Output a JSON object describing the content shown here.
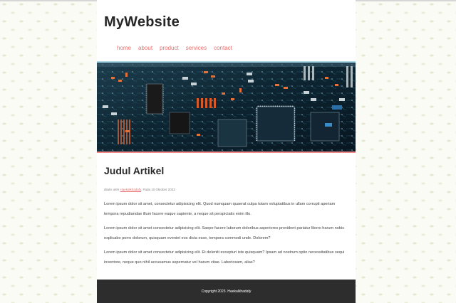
{
  "site": {
    "title": "MyWebsite"
  },
  "nav": {
    "items": [
      "home",
      "about",
      "product",
      "services",
      "contact"
    ]
  },
  "banner": {
    "image": "circuit-board-photo"
  },
  "article": {
    "title": "Judul Artikel",
    "meta_prefix": "ditulis oleh",
    "meta_author": "Haekalkhadafy",
    "meta_suffix": ", Pada 10 Oktober 2023",
    "paragraphs": [
      "Lorem ipsum dolor sit amet, consectetur adipisicing elit. Quod numquam quaerat culpa totam voluptatibus in ullam corrupti aperiam tempora repudiandae illum facere eaque sapiente, a neque sit perspiciatis enim illo.",
      "Lorem ipsum dolor sit amet consectetur adipisicing elit. Saepe facere laborum doloribus asperiores provident pariatur libero harum nobis explicabo porro dolorum, quisquam eveniet eos dicta esse, tempora commodi unde. Dolorem?",
      "Lorem ipsum dolor sit amet consectetur adipisicing elit. Et deleniti excepturi iste quisquam? Ipsam ad nostrum optio necessitatibus sequi inventore, neque quo nihil accusamus aspernatur vel harum vitae. Laboriosam, alias?"
    ]
  },
  "footer": {
    "text": "Copyright 2023. Haekalkhadafy"
  },
  "colors": {
    "accent": "#e8706e",
    "banner_top_border": "#a7d8ea",
    "footer_bg": "#2d2d2d",
    "title_text": "#262626"
  }
}
